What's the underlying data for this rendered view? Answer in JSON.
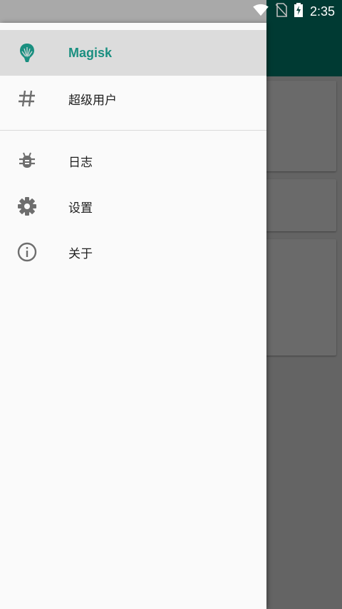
{
  "status_bar": {
    "time": "2:35",
    "icons": [
      "wifi-icon",
      "no-sim-icon",
      "battery-charging-icon"
    ]
  },
  "colors": {
    "accent": "#1a8f80",
    "toolbar": "#003a33",
    "drawer_bg": "#fafafa",
    "active_bg": "#dcdcdc",
    "icon_gray": "#6e6e6e"
  },
  "drawer": {
    "items": [
      {
        "label": "Magisk",
        "icon": "magisk-logo-icon",
        "active": true
      },
      {
        "label": "超级用户",
        "icon": "hash-icon",
        "active": false
      },
      {
        "label": "日志",
        "icon": "bug-icon",
        "active": false
      },
      {
        "label": "设置",
        "icon": "gear-icon",
        "active": false
      },
      {
        "label": "关于",
        "icon": "info-icon",
        "active": false
      }
    ]
  }
}
